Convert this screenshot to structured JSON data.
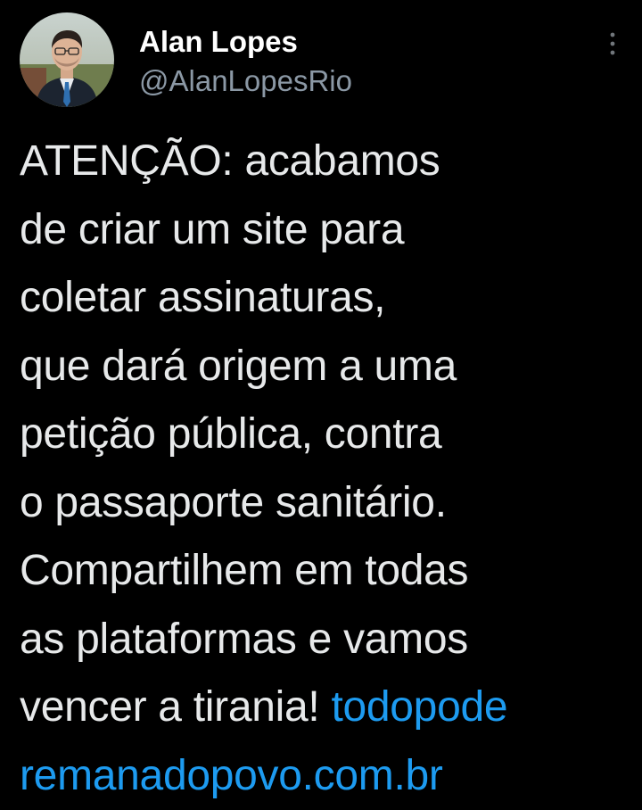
{
  "author": {
    "name": "Alan Lopes",
    "handle": "@AlanLopesRio"
  },
  "tweet": {
    "lines": [
      "ATENÇÃO: acabamos",
      "de criar um site para",
      "coletar assinaturas,",
      "que dará origem a uma",
      "petição pública, contra",
      "o passaporte sanitário.",
      "Compartilhem em todas",
      "as plataformas e vamos",
      "vencer a tirania! "
    ],
    "link_part1": "todopode",
    "link_part2": "remanadopovo.com.br"
  },
  "icons": {
    "more": "more-options-icon"
  },
  "colors": {
    "background": "#000000",
    "text": "#e7e9ea",
    "secondary": "#8b98a5",
    "link": "#1d9bf0"
  }
}
